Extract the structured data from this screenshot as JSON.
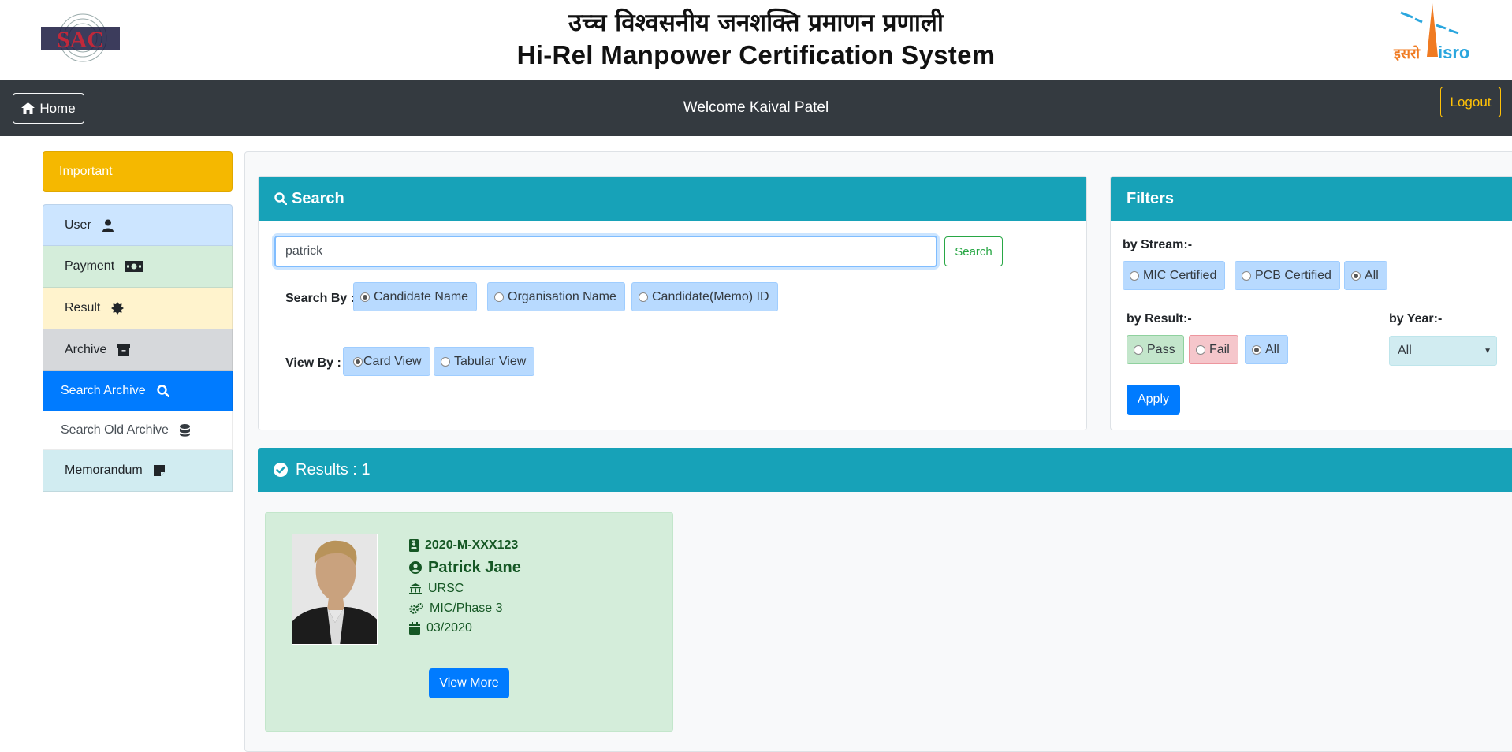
{
  "header": {
    "title_hindi": "उच्च विश्वसनीय जनशक्ति प्रमाणन प्रणाली",
    "title_english": "Hi-Rel Manpower Certification System",
    "logo_left": "SAC",
    "logo_right_hindi": "इसरो",
    "logo_right_english": "isro"
  },
  "navbar": {
    "home_label": "Home",
    "welcome_text": "Welcome Kaival Patel",
    "logout_label": "Logout"
  },
  "sidebar": {
    "important_label": "Important",
    "items": [
      {
        "label": "User",
        "icon": "user-icon"
      },
      {
        "label": "Payment",
        "icon": "money-icon"
      },
      {
        "label": "Result",
        "icon": "certificate-icon"
      },
      {
        "label": "Archive",
        "icon": "archive-icon"
      },
      {
        "label": "Search Archive",
        "icon": "search-icon"
      },
      {
        "label": "Search Old Archive",
        "icon": "database-icon"
      },
      {
        "label": "Memorandum",
        "icon": "sticky-note-icon"
      }
    ]
  },
  "search": {
    "heading": "Search",
    "input_value": "patrick",
    "button_label": "Search",
    "search_by_label": "Search By :",
    "search_by_options": [
      "Candidate Name",
      "Organisation Name",
      "Candidate(Memo) ID"
    ],
    "search_by_selected": "Candidate Name",
    "view_by_label": "View By :",
    "view_by_options": [
      "Card View",
      "Tabular View"
    ],
    "view_by_selected": "Card View"
  },
  "filters": {
    "heading": "Filters",
    "stream_label": "by Stream:-",
    "stream_options": [
      "MIC Certified",
      "PCB Certified",
      "All"
    ],
    "stream_selected": "All",
    "result_label": "by Result:-",
    "result_options": [
      "Pass",
      "Fail",
      "All"
    ],
    "result_selected": "All",
    "year_label": "by Year:-",
    "year_selected": "All",
    "apply_label": "Apply"
  },
  "results": {
    "heading": "Results : 1",
    "cards": [
      {
        "memo_id": "2020-M-XXX123",
        "name": "Patrick Jane",
        "organisation": "URSC",
        "stream_phase": "MIC/Phase 3",
        "date": "03/2020",
        "button_label": "View More"
      }
    ]
  },
  "colors": {
    "navbar": "#343a40",
    "info": "#17a2b8",
    "primary": "#007bff",
    "warning": "#ffc107",
    "success_text": "#155724"
  }
}
